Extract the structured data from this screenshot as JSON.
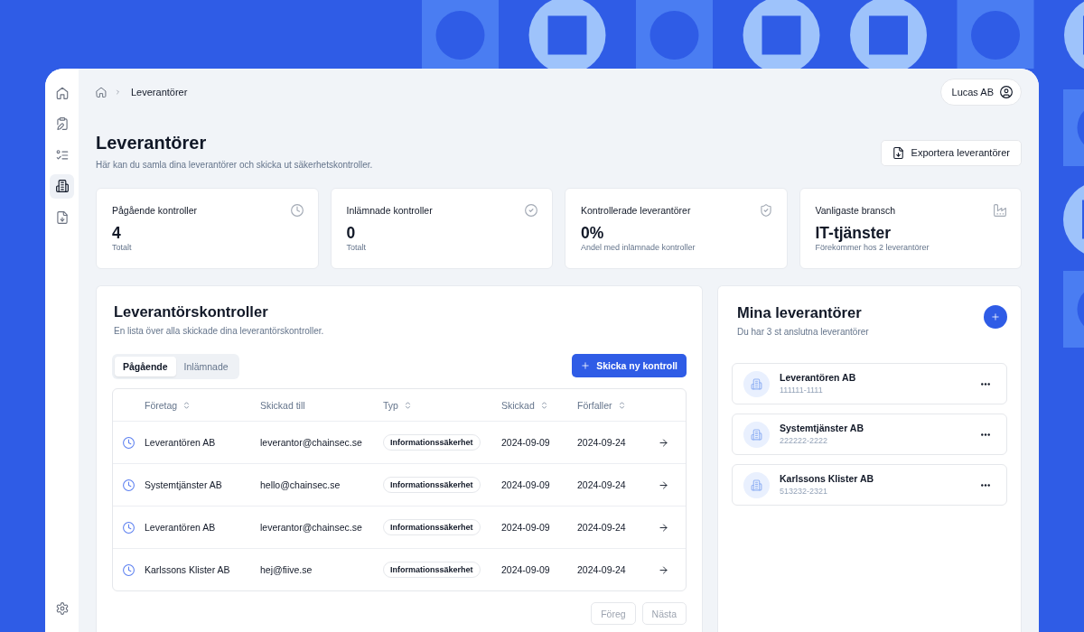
{
  "sidebar": {
    "items": [
      {
        "selected": false
      },
      {
        "selected": false
      },
      {
        "selected": false
      },
      {
        "selected": true
      },
      {
        "selected": false
      }
    ]
  },
  "breadcrumb": {
    "current": "Leverantörer"
  },
  "account": {
    "label": "Lucas AB"
  },
  "page": {
    "title": "Leverantörer",
    "subtitle": "Här kan du samla dina leverantörer och skicka ut säkerhetskontroller.",
    "export_button": "Exportera leverantörer"
  },
  "stats": [
    {
      "title": "Pågående kontroller",
      "value": "4",
      "caption": "Totalt"
    },
    {
      "title": "Inlämnade kontroller",
      "value": "0",
      "caption": "Totalt"
    },
    {
      "title": "Kontrollerade leverantörer",
      "value": "0%",
      "caption": "Andel med inlämnade kontroller"
    },
    {
      "title": "Vanligaste bransch",
      "value": "IT-tjänster",
      "caption": "Förekommer hos 2 leverantörer"
    }
  ],
  "controls": {
    "title": "Leverantörskontroller",
    "subtitle": "En lista över alla skickade dina leverantörskontroller.",
    "tabs": [
      {
        "label": "Pågående",
        "selected": true
      },
      {
        "label": "Inlämnade",
        "selected": false
      }
    ],
    "new_button": "Skicka ny kontroll",
    "table": {
      "columns": [
        {
          "label": "Företag",
          "sortable": true
        },
        {
          "label": "Skickad till",
          "sortable": false
        },
        {
          "label": "Typ",
          "sortable": true
        },
        {
          "label": "Skickad",
          "sortable": true
        },
        {
          "label": "Förfaller",
          "sortable": true
        }
      ],
      "rows": [
        {
          "company": "Leverantören AB",
          "sent_to": "leverantor@chainsec.se",
          "type": "Informationssäkerhet",
          "sent": "2024-09-09",
          "due": "2024-09-24"
        },
        {
          "company": "Systemtjänster AB",
          "sent_to": "hello@chainsec.se",
          "type": "Informationssäkerhet",
          "sent": "2024-09-09",
          "due": "2024-09-24"
        },
        {
          "company": "Leverantören AB",
          "sent_to": "leverantor@chainsec.se",
          "type": "Informationssäkerhet",
          "sent": "2024-09-09",
          "due": "2024-09-24"
        },
        {
          "company": "Karlssons Klister AB",
          "sent_to": "hej@fiive.se",
          "type": "Informationssäkerhet",
          "sent": "2024-09-09",
          "due": "2024-09-24"
        }
      ]
    },
    "pagination": [
      {
        "label": "Föreg",
        "disabled": true
      },
      {
        "label": "Nästa",
        "disabled": true
      }
    ]
  },
  "suppliers": {
    "title": "Mina leverantörer",
    "subtitle": "Du har 3 st anslutna leverantörer",
    "items": [
      {
        "name": "Leverantören AB",
        "org_number": "111111-1111"
      },
      {
        "name": "Systemtjänster AB",
        "org_number": "222222-2222"
      },
      {
        "name": "Karlssons Klister AB",
        "org_number": "513232-2321"
      }
    ]
  }
}
